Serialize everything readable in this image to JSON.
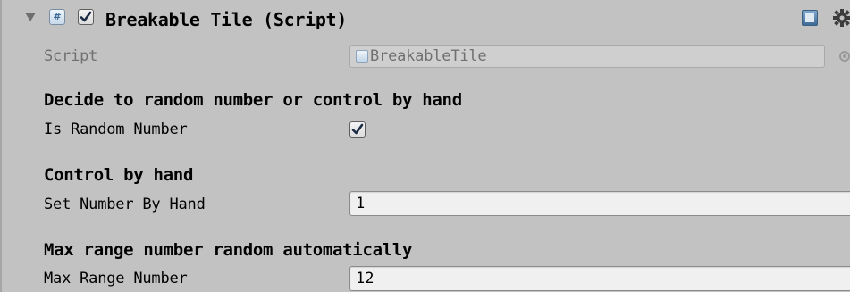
{
  "component": {
    "title": "Breakable Tile (Script)",
    "enabled": true,
    "script_label": "Script",
    "script_value": "BreakableTile"
  },
  "sections": {
    "random_header": "Decide to random number or control by hand",
    "is_random_label": "Is Random Number",
    "is_random_checked": true,
    "hand_header": "Control by hand",
    "set_number_label": "Set Number By Hand",
    "set_number_value": "1",
    "max_header": "Max range number random automatically",
    "max_range_label": "Max Range Number",
    "max_range_value": "12"
  },
  "icons": {
    "foldout": "triangle-down-icon",
    "script": "csharp-script-icon",
    "help": "help-book-icon",
    "settings": "gear-icon",
    "picker": "object-picker-icon"
  },
  "colors": {
    "panel_bg": "#c2c2c2",
    "disabled_text": "#707070",
    "field_bg": "#f0f0f0",
    "script_icon": "#3d6a95"
  }
}
